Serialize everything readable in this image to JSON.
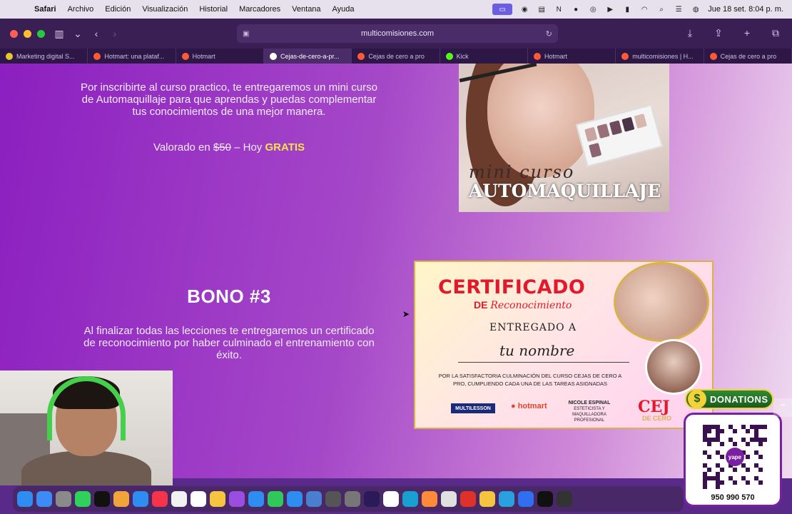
{
  "menubar": {
    "apple": "",
    "items": [
      "Safari",
      "Archivo",
      "Edición",
      "Visualización",
      "Historial",
      "Marcadores",
      "Ventana",
      "Ayuda"
    ],
    "clock": "Jue 18 set.  8:04 p. m."
  },
  "toolbar": {
    "url": "multicomisiones.com"
  },
  "tabs": [
    {
      "label": "Marketing digital S...",
      "color": "#e7c62a",
      "active": false
    },
    {
      "label": "Hotmart: una plataf...",
      "color": "#ff5a36",
      "active": false
    },
    {
      "label": "Hotmart",
      "color": "#ff5a36",
      "active": false
    },
    {
      "label": "Cejas-de-cero-a-pr...",
      "color": "#ffffff",
      "active": true
    },
    {
      "label": "Cejas de cero a pro",
      "color": "#ff5a36",
      "active": false
    },
    {
      "label": "Kick",
      "color": "#53fc18",
      "active": false
    },
    {
      "label": "Hotmart",
      "color": "#ff5a36",
      "active": false
    },
    {
      "label": "multicomisiones | H...",
      "color": "#ff5a36",
      "active": false
    },
    {
      "label": "Cejas de cero a pro",
      "color": "#ff5a36",
      "active": false
    }
  ],
  "content": {
    "bonus2_text": "Por inscribirte al curso practico, te entregaremos un mini curso de Automaquillaje para que aprendas y puedas complementar tus conocimientos de una mejor manera.",
    "valor_prefix": "Valorado en ",
    "valor_price": "$50",
    "valor_mid": " – Hoy ",
    "valor_gratis": "GRATIS",
    "bono3_title": "BONO #3",
    "bonus3_text": "Al finalizar todas las lecciones te entregaremos un certificado de reconocimiento por haber culminado el entrenamiento con éxito."
  },
  "promo_image": {
    "line1": "mini curso",
    "line2": "AUTOMAQUILLAJE"
  },
  "certificate": {
    "title": "CERTIFICADO",
    "sub_de": "DE ",
    "sub_script": "Reconocimiento",
    "entregado": "ENTREGADO A",
    "nombre": "tu nombre",
    "desc": "POR LA SATISFACTORIA CULMINACIÓN DEL CURSO CEJAS DE CERO A PRO, CUMPLIENDO CADA UNA DE LAS TAREAS ASIGNADAS",
    "logo_multilesson": "MULTILESSON",
    "logo_hotmart": "hotmart",
    "signer_name": "NICOLE ESPINAL",
    "signer_role": "ESTETICISTA Y MAQUILLADORA PROFESIONAL",
    "brand": "CEJ",
    "brand_sub": "DE CERO"
  },
  "donations": {
    "label": "DONATIONS",
    "coin": "$",
    "qr_logo": "yape",
    "phone": "950 990 570"
  },
  "dock": {
    "apps": [
      {
        "name": "finder",
        "color": "#2f8cf0"
      },
      {
        "name": "mail",
        "color": "#3d8bf5"
      },
      {
        "name": "launchpad",
        "color": "#8a8a8a"
      },
      {
        "name": "messages",
        "color": "#2ed15a"
      },
      {
        "name": "tv",
        "color": "#111111"
      },
      {
        "name": "photos",
        "color": "#f0a53a"
      },
      {
        "name": "safari",
        "color": "#2f8cf0"
      },
      {
        "name": "music",
        "color": "#f5344a"
      },
      {
        "name": "reminders",
        "color": "#f2f2f2"
      },
      {
        "name": "calendar",
        "color": "#ffffff"
      },
      {
        "name": "notes",
        "color": "#f5c542"
      },
      {
        "name": "podcasts",
        "color": "#9b4de0"
      },
      {
        "name": "keynote",
        "color": "#2f8cf0"
      },
      {
        "name": "numbers",
        "color": "#2ec95a"
      },
      {
        "name": "app-store",
        "color": "#2f8cf0"
      },
      {
        "name": "preview",
        "color": "#4a7fd0"
      },
      {
        "name": "screenshot",
        "color": "#555555"
      },
      {
        "name": "settings",
        "color": "#777777"
      },
      {
        "name": "premiere",
        "color": "#2a1a5a"
      },
      {
        "name": "notion",
        "color": "#ffffff"
      },
      {
        "name": "finder-2",
        "color": "#1aa0d0"
      },
      {
        "name": "sublime",
        "color": "#ff8a3a"
      },
      {
        "name": "preview-2",
        "color": "#e0e0e0"
      },
      {
        "name": "pdf",
        "color": "#e0302a"
      },
      {
        "name": "chrome",
        "color": "#f5c542"
      },
      {
        "name": "telegram",
        "color": "#2aa0e0"
      },
      {
        "name": "zoom",
        "color": "#2f6ff0"
      },
      {
        "name": "capcut",
        "color": "#111111"
      },
      {
        "name": "obs",
        "color": "#333333"
      }
    ]
  },
  "colors": {
    "gratis": "#f7e34b",
    "page_gradient_start": "#8c1fc0",
    "page_gradient_end": "#f0dcf0",
    "cert_red": "#e4182b"
  }
}
